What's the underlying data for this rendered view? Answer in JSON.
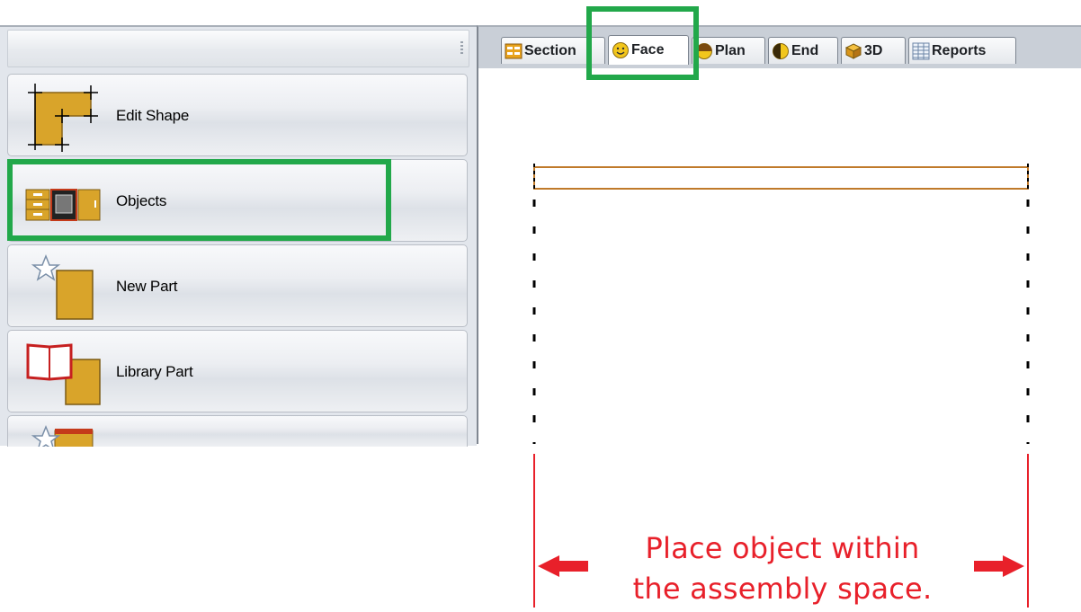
{
  "tabs": [
    {
      "label": "Section",
      "icon": "section-icon"
    },
    {
      "label": "Face",
      "icon": "smiley-face-icon",
      "active": true
    },
    {
      "label": "Plan",
      "icon": "plan-icon"
    },
    {
      "label": "End",
      "icon": "end-icon"
    },
    {
      "label": "3D",
      "icon": "cube-3d-icon"
    },
    {
      "label": "Reports",
      "icon": "reports-icon"
    }
  ],
  "sidebar": {
    "items": [
      {
        "label": "Edit Shape",
        "icon": "edit-shape-icon"
      },
      {
        "label": "Objects",
        "icon": "objects-icon"
      },
      {
        "label": "New Part",
        "icon": "new-part-icon"
      },
      {
        "label": "Library Part",
        "icon": "library-part-icon"
      },
      {
        "label": "",
        "icon": "new-assembly-icon"
      }
    ]
  },
  "annotation": {
    "line1": "Place object within",
    "line2": "the assembly space.",
    "color": "#e8202a"
  },
  "colors": {
    "highlight": "#22a84a",
    "part_outline": "#c07a2a",
    "icon_gold": "#d9a42a"
  }
}
